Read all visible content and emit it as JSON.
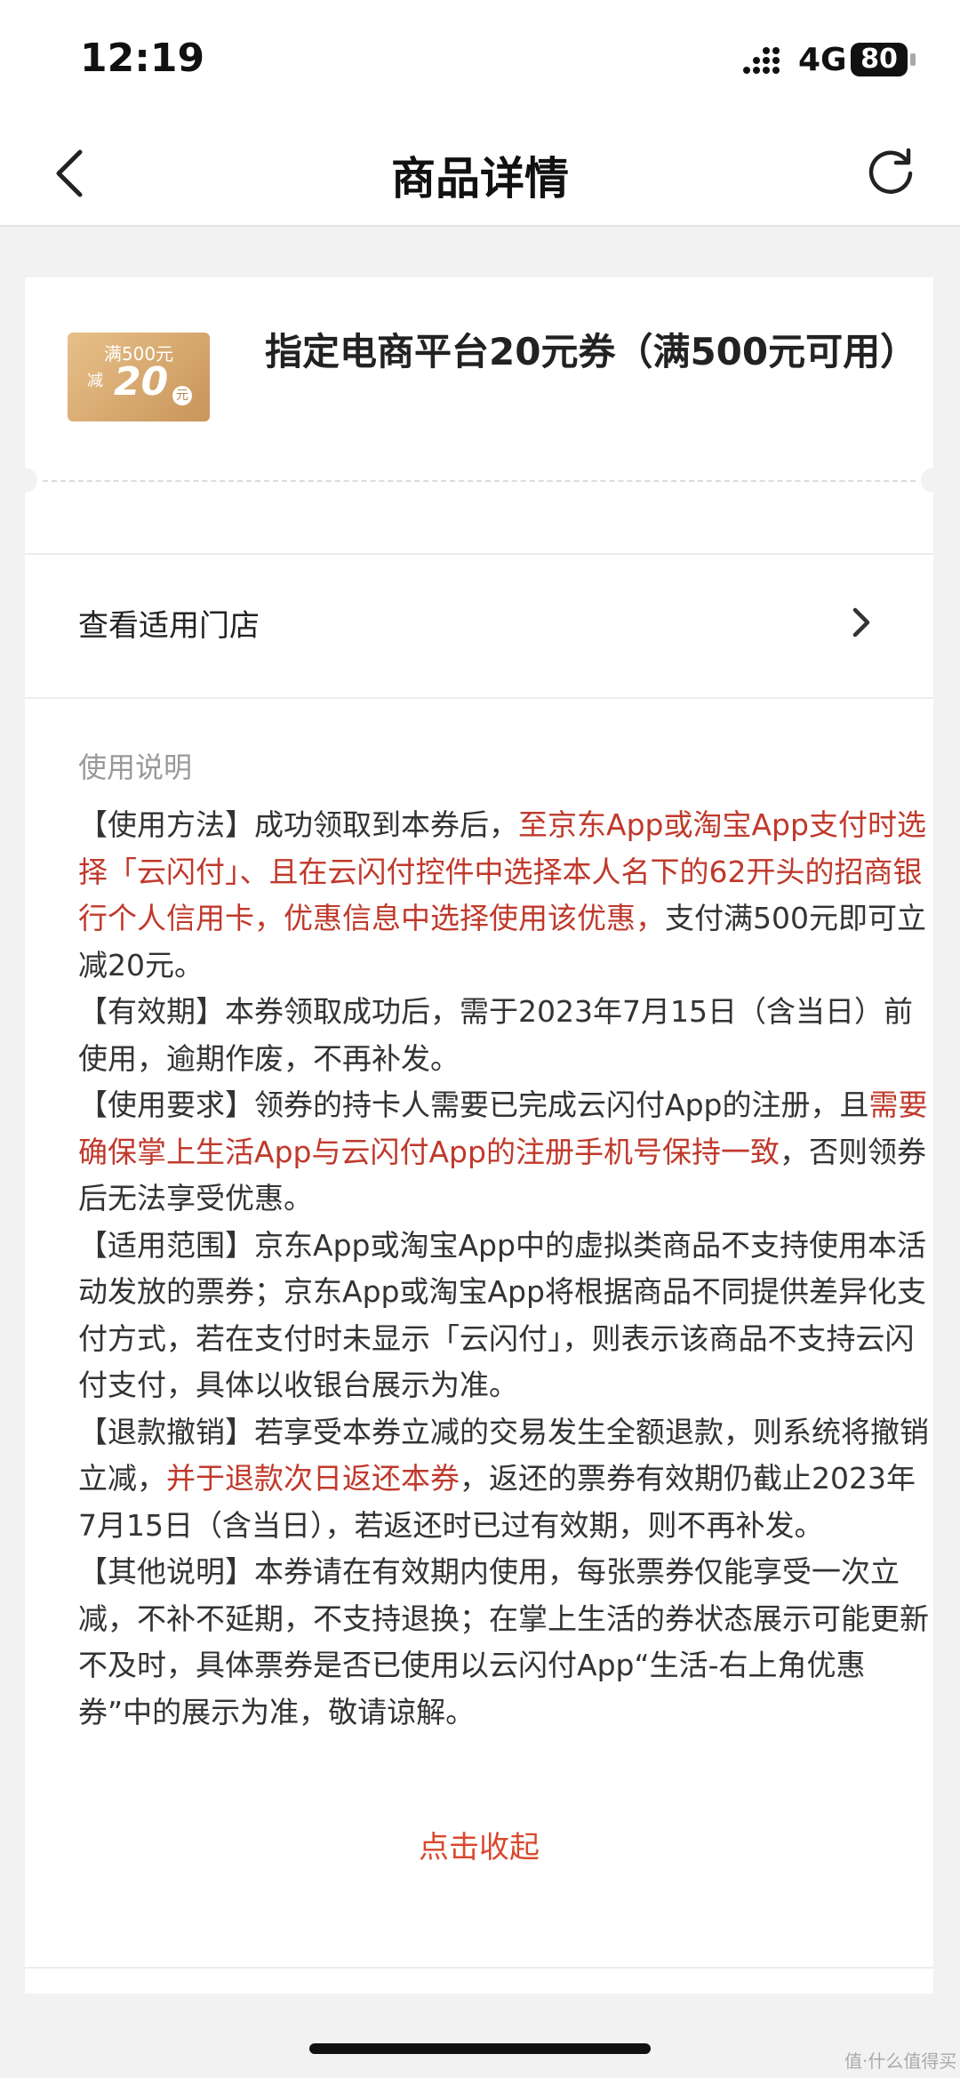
{
  "status_bar": {
    "time": "12:19",
    "network": "4G",
    "battery": "80"
  },
  "navbar": {
    "title": "商品详情"
  },
  "product": {
    "coupon_badge": {
      "threshold": "满500元",
      "prefix": "减",
      "amount": "20",
      "unit": "元"
    },
    "title": "指定电商平台20元券（满500元可用）"
  },
  "store_row": {
    "label": "查看适用门店"
  },
  "usage": {
    "heading": "使用说明",
    "paragraphs": [
      [
        {
          "text": "【使用方法】成功领取到本券后，",
          "red": false
        },
        {
          "text": "至京东App或淘宝App支付时选择「云闪付」、且在云闪付控件中选择本人名下的62开头的招商银行个人信用卡，优惠信息中选择使用该优惠，",
          "red": true
        },
        {
          "text": "支付满500元即可立减20元。",
          "red": false
        }
      ],
      [
        {
          "text": "【有效期】本券领取成功后，需于2023年7月15日（含当日）前使用，逾期作废，不再补发。",
          "red": false
        }
      ],
      [
        {
          "text": "【使用要求】领券的持卡人需要已完成云闪付App的注册，且",
          "red": false
        },
        {
          "text": "需要确保掌上生活App与云闪付App的注册手机号保持一致",
          "red": true
        },
        {
          "text": "，否则领券后无法享受优惠。",
          "red": false
        }
      ],
      [
        {
          "text": "【适用范围】京东App或淘宝App中的虚拟类商品不支持使用本活动发放的票券；京东App或淘宝App将根据商品不同提供差异化支付方式，若在支付时未显示「云闪付」，则表示该商品不支持云闪付支付，具体以收银台展示为准。",
          "red": false
        }
      ],
      [
        {
          "text": "【退款撤销】若享受本券立减的交易发生全额退款，则系统将撤销立减，",
          "red": false
        },
        {
          "text": "并于退款次日返还本券",
          "red": true
        },
        {
          "text": "，返还的票券有效期仍截止2023年7月15日（含当日），若返还时已过有效期，则不再补发。",
          "red": false
        }
      ],
      [
        {
          "text": "【其他说明】本券请在有效期内使用，每张票券仅能享受一次立减，不补不延期，不支持退换；在掌上生活的券状态展示可能更新不及时，具体票券是否已使用以云闪付App“生活-右上角优惠券”中的展示为准，敬请谅解。",
          "red": false
        }
      ]
    ],
    "collapse_label": "点击收起"
  },
  "watermark": "值·什么值得买",
  "colors": {
    "accent_red": "#c0392b",
    "link_red": "#d9482e",
    "coupon_gold": "#d4a56c"
  }
}
